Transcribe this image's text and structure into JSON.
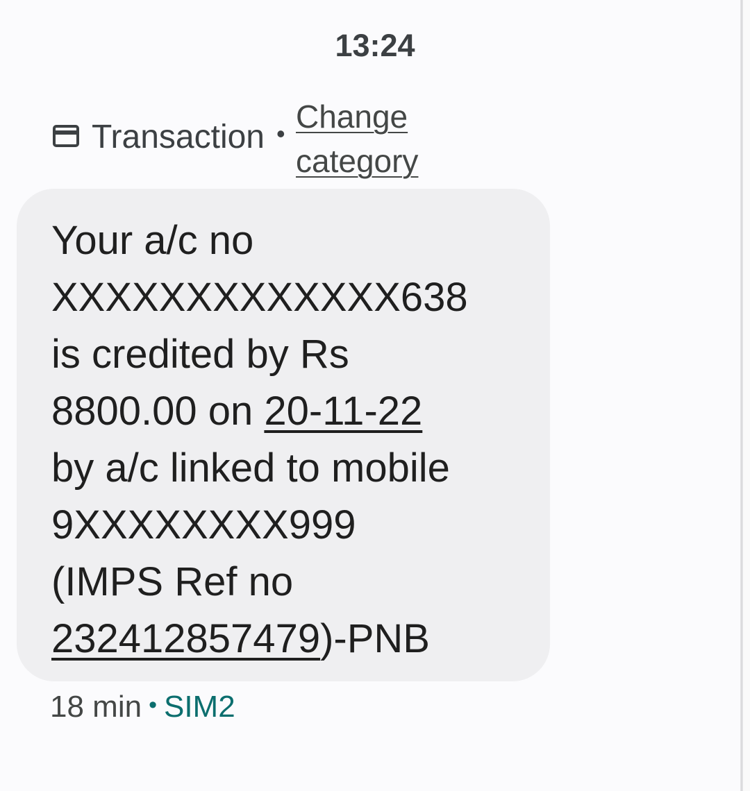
{
  "status": {
    "time": "13:24"
  },
  "category": {
    "icon": "credit-card-icon",
    "label": "Transaction",
    "separator": "•",
    "change_link": "Change category"
  },
  "message": {
    "line1": "Your a/c no",
    "line2": "XXXXXXXXXXXXX638",
    "line3": "is credited by Rs",
    "line4_prefix": "8800.00 on ",
    "line4_date": "20-11-22",
    "line5": "by a/c linked to mobile",
    "line6": "9XXXXXXXX999",
    "line7": "(IMPS Ref no",
    "line8_ref": "232412857479",
    "line8_suffix": ")-PNB"
  },
  "meta": {
    "age": "18 min",
    "separator": "•",
    "sim": "SIM2"
  },
  "colors": {
    "background": "#fbfbfd",
    "bubble": "#efeff1",
    "text": "#1f1f1f",
    "sim_accent": "#0b6e6e"
  }
}
